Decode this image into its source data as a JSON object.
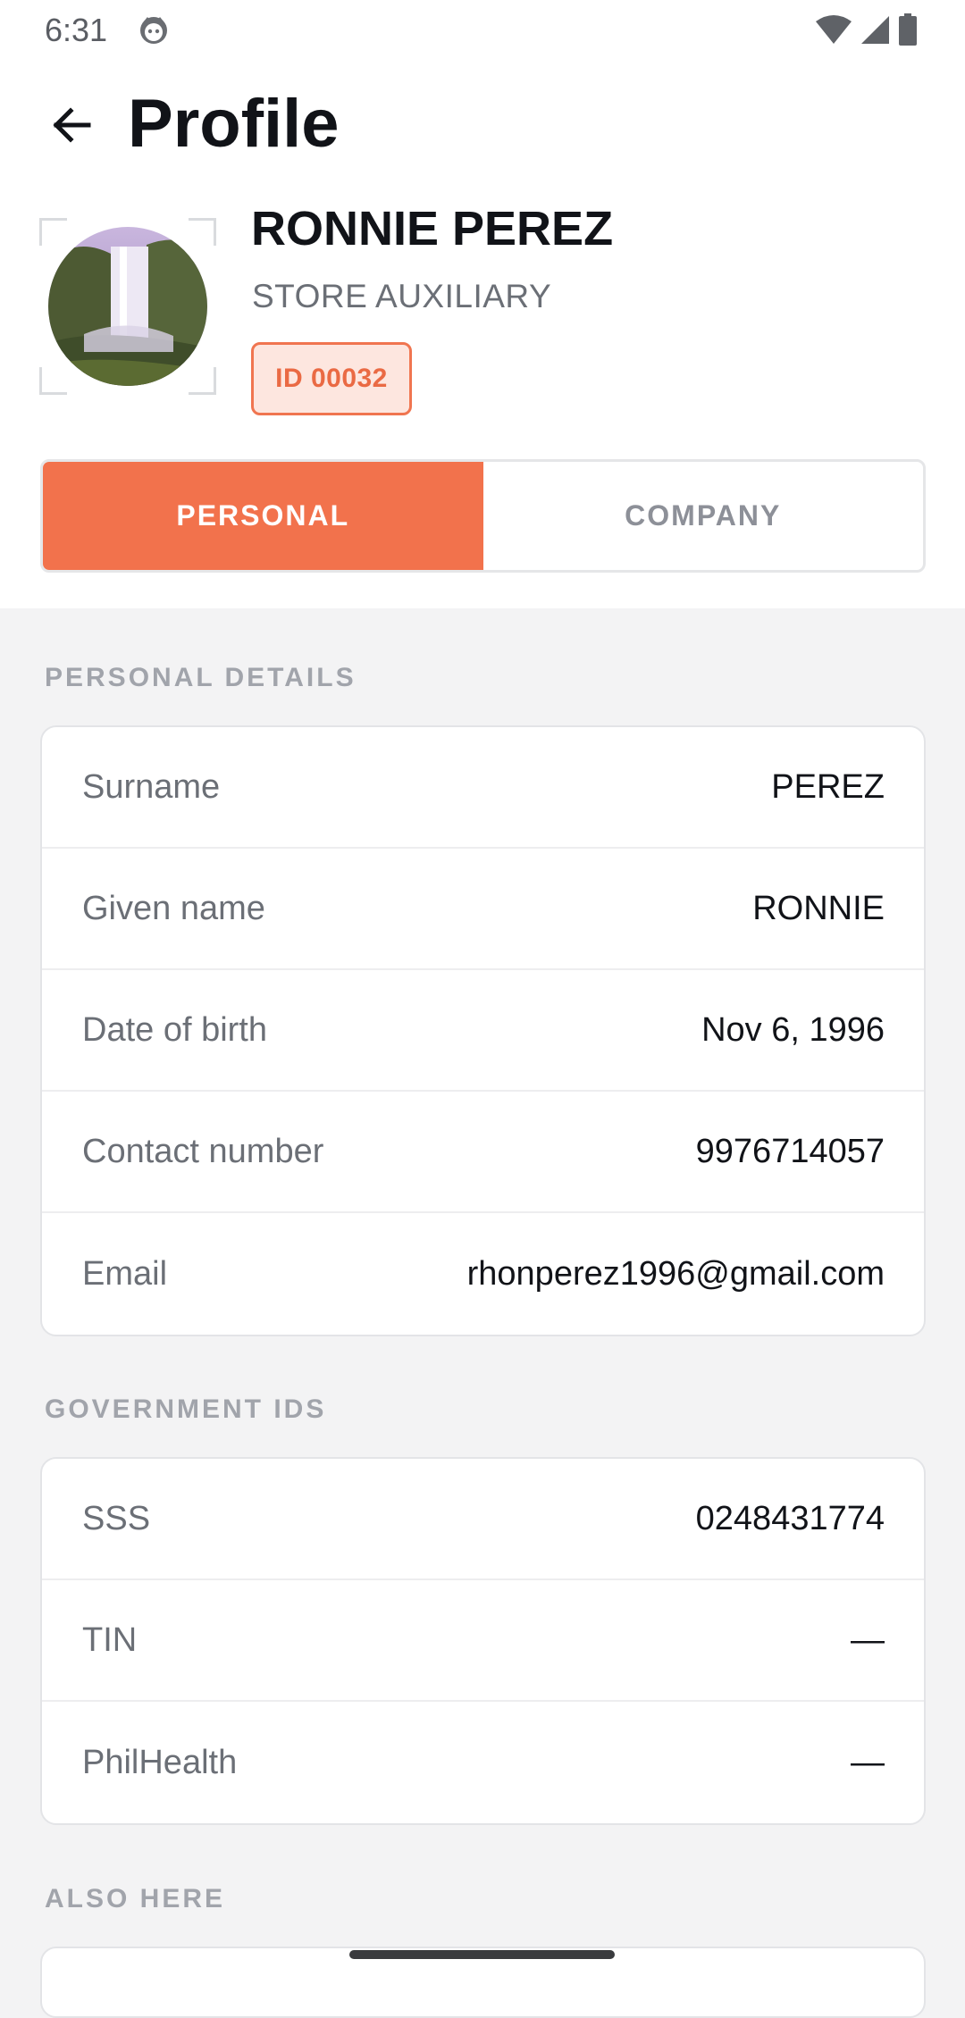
{
  "status_bar": {
    "time": "6:31",
    "icons": [
      "face-icon",
      "wifi-icon",
      "signal-icon",
      "battery-icon"
    ]
  },
  "header": {
    "title": "Profile",
    "back_icon": "arrow-left-icon"
  },
  "profile": {
    "name": "RONNIE PEREZ",
    "role": "STORE AUXILIARY",
    "id_badge": "ID 00032"
  },
  "tabs": [
    {
      "label": "PERSONAL",
      "active": true
    },
    {
      "label": "COMPANY",
      "active": false
    }
  ],
  "sections": {
    "personal_details": {
      "title": "PERSONAL DETAILS",
      "rows": [
        {
          "label": "Surname",
          "value": "PEREZ"
        },
        {
          "label": "Given name",
          "value": "RONNIE"
        },
        {
          "label": "Date of birth",
          "value": "Nov 6, 1996"
        },
        {
          "label": "Contact number",
          "value": "9976714057"
        },
        {
          "label": "Email",
          "value": "rhonperez1996@gmail.com"
        }
      ]
    },
    "government_ids": {
      "title": "GOVERNMENT IDS",
      "rows": [
        {
          "label": "SSS",
          "value": "0248431774"
        },
        {
          "label": "TIN",
          "value": "—"
        },
        {
          "label": "PhilHealth",
          "value": "—"
        }
      ]
    },
    "also_here": {
      "title": "ALSO HERE"
    }
  },
  "colors": {
    "accent": "#f2724c",
    "badge_bg": "#fde6df",
    "page_bg": "#f3f3f4",
    "muted_text": "#6b6f76",
    "section_label": "#a1a4ab"
  }
}
